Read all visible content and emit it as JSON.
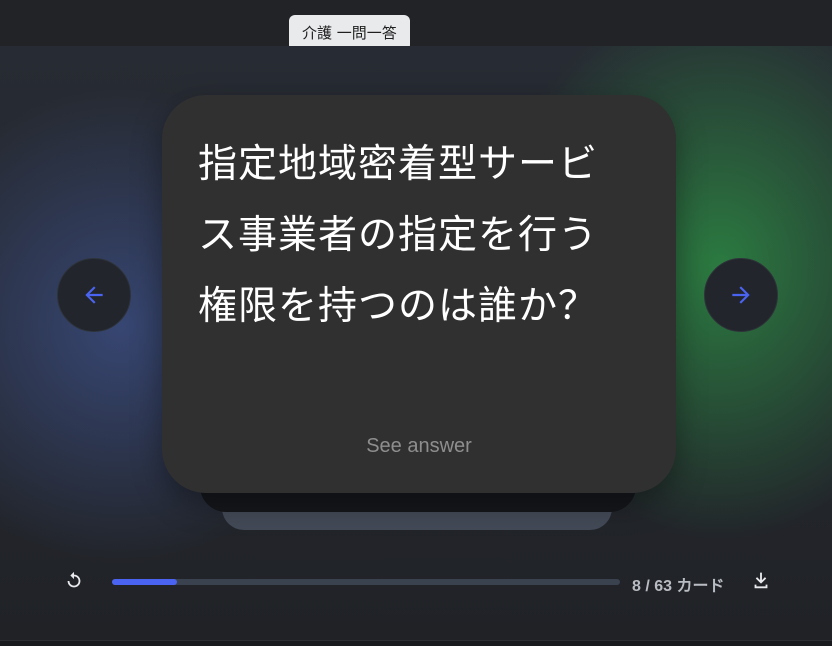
{
  "deck": {
    "title": "介護 一問一答"
  },
  "card": {
    "question": "指定地域密着型サービス事業者の指定を行う権限を持つのは誰か？",
    "reveal_label": "See answer"
  },
  "navigation": {
    "prev_icon": "arrow-left-icon",
    "next_icon": "arrow-right-icon"
  },
  "footer": {
    "restart_icon": "restart-icon",
    "download_icon": "download-icon",
    "progress": {
      "current": 8,
      "total": 63,
      "fraction": 0.127
    },
    "counter_text": "8 / 63 カード"
  },
  "colors": {
    "accent": "#4a63f0",
    "card_bg": "#303030",
    "track": "#3a4250"
  }
}
